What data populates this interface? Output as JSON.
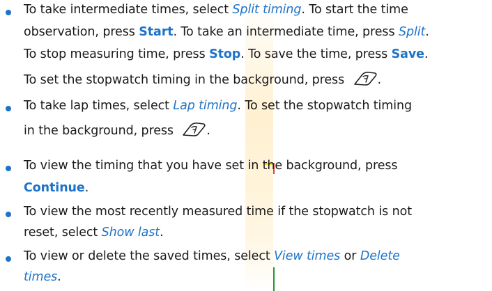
{
  "bullets": [
    {
      "lines": [
        [
          "To take intermediate times, select ",
          {
            "t": "Split timing",
            "s": "em"
          },
          ". To start the time"
        ],
        [
          "observation, press ",
          {
            "t": "Start",
            "s": "bold"
          },
          ". To take an intermediate time, press ",
          {
            "t": "Split",
            "s": "em"
          },
          "."
        ],
        [
          "To stop measuring time, press ",
          {
            "t": "Stop",
            "s": "bold"
          },
          ". To save the time, press ",
          {
            "t": "Save",
            "s": "bold"
          },
          "."
        ],
        [
          "To set the stopwatch timing in the background, press ",
          {
            "icon": "end-key-icon"
          },
          "."
        ]
      ]
    },
    {
      "lines": [
        [
          "To take lap times, select ",
          {
            "t": "Lap timing",
            "s": "em"
          },
          ". To set the stopwatch timing"
        ],
        [
          "in the background, press ",
          {
            "icon": "end-key-icon"
          },
          "."
        ]
      ]
    },
    {
      "lines": [
        [
          "To view the timing that you have set in the background, press"
        ],
        [
          {
            "t": "Continue",
            "s": "bold"
          },
          "."
        ]
      ]
    },
    {
      "lines": [
        [
          "To view the most recently measured time if the stopwatch is not"
        ],
        [
          "reset, select ",
          {
            "t": "Show last",
            "s": "em"
          },
          "."
        ]
      ]
    },
    {
      "lines": [
        [
          "To view or delete the saved times, select ",
          {
            "t": "View times",
            "s": "em"
          },
          " or ",
          {
            "t": "Delete",
            "s": "em"
          }
        ],
        [
          {
            "t": "times",
            "s": "em"
          },
          "."
        ]
      ]
    }
  ]
}
